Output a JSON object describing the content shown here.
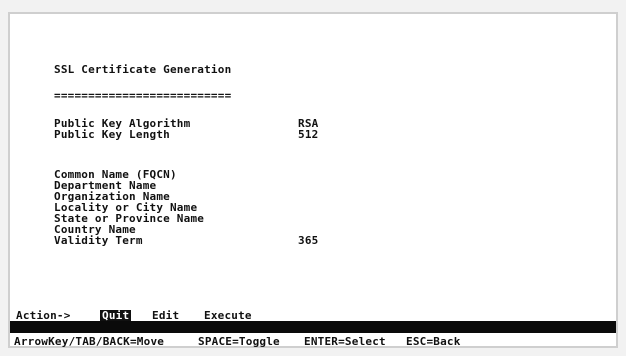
{
  "screen": {
    "title": "SSL Certificate Generation",
    "underline": "=========================="
  },
  "key_fields": [
    {
      "label": "Public Key Algorithm",
      "value": "RSA"
    },
    {
      "label": "Public Key Length",
      "value": "512"
    }
  ],
  "cert_fields": [
    {
      "label": "Common Name (FQCN)",
      "value": ""
    },
    {
      "label": "Department Name",
      "value": ""
    },
    {
      "label": "Organization Name",
      "value": ""
    },
    {
      "label": "Locality or City Name",
      "value": ""
    },
    {
      "label": "State or Province Name",
      "value": ""
    },
    {
      "label": "Country Name",
      "value": ""
    },
    {
      "label": "Validity Term",
      "value": "365"
    }
  ],
  "action_bar": {
    "prompt": "Action->",
    "items": [
      "Quit",
      "Edit",
      "Execute"
    ],
    "selected": "Quit"
  },
  "help": {
    "move": "ArrowKey/TAB/BACK=Move",
    "toggle": "SPACE=Toggle",
    "select": "ENTER=Select",
    "back": "ESC=Back"
  }
}
